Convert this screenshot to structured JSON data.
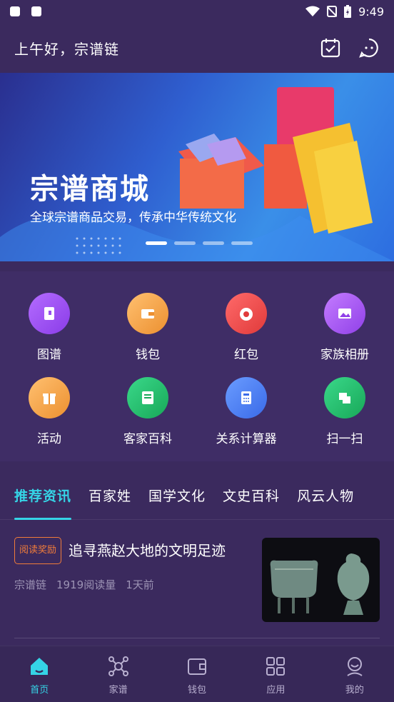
{
  "status": {
    "time": "9:49"
  },
  "header": {
    "greeting": "上午好，宗谱链"
  },
  "banner": {
    "title": "宗谱商城",
    "subtitle": "全球宗谱商品交易，传承中华传统文化"
  },
  "quick_actions": [
    {
      "label": "图谱",
      "icon": "book-icon",
      "color": "#9a4ff0"
    },
    {
      "label": "钱包",
      "icon": "wallet-icon",
      "color": "#f0a040"
    },
    {
      "label": "红包",
      "icon": "red-envelope-icon",
      "color": "#f04a4a"
    },
    {
      "label": "家族相册",
      "icon": "photo-album-icon",
      "color": "#a24ff0"
    },
    {
      "label": "活动",
      "icon": "gift-icon",
      "color": "#f0a040"
    },
    {
      "label": "客家百科",
      "icon": "encyclopedia-icon",
      "color": "#22b868"
    },
    {
      "label": "关系计算器",
      "icon": "calculator-icon",
      "color": "#4a80f0"
    },
    {
      "label": "扫一扫",
      "icon": "scan-icon",
      "color": "#22b868"
    }
  ],
  "tabs": [
    "推荐资讯",
    "百家姓",
    "国学文化",
    "文史百科",
    "风云人物"
  ],
  "article": {
    "badge": "阅读奖励",
    "title": "追寻燕赵大地的文明足迹",
    "author": "宗谱链",
    "reads": "1919阅读量",
    "time": "1天前"
  },
  "bottom_nav": [
    "首页",
    "家谱",
    "钱包",
    "应用",
    "我的"
  ]
}
